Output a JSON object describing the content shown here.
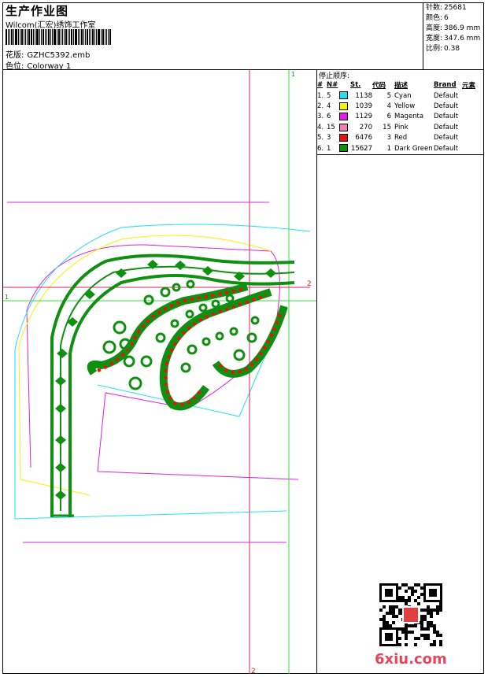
{
  "header": {
    "title": "生产作业图",
    "company": "Wilcom(汇宏)绣饰工作室",
    "design_label": "花版:",
    "design_value": "GZHC5392.emb",
    "colorway_label": "色位:",
    "colorway_value": "Colorway 1"
  },
  "stats": [
    {
      "label": "针数:",
      "value": "25681"
    },
    {
      "label": "颜色:",
      "value": "6"
    },
    {
      "label": "高度:",
      "value": "386.9 mm"
    },
    {
      "label": "宽度:",
      "value": "347.6 mm"
    },
    {
      "label": "比例:",
      "value": "0.38"
    }
  ],
  "stop_sequence": {
    "title": "停止顺序:",
    "columns": [
      "#",
      "N#",
      "St.",
      "代码",
      "描述",
      "Brand",
      "元素"
    ],
    "rows": [
      {
        "seq": "1.",
        "n": "5",
        "stitches": "1138",
        "code": "5",
        "desc": "Cyan",
        "brand": "Default",
        "color": "#22e0f0"
      },
      {
        "seq": "2.",
        "n": "4",
        "stitches": "1039",
        "code": "4",
        "desc": "Yellow",
        "brand": "Default",
        "color": "#f4f400"
      },
      {
        "seq": "3.",
        "n": "6",
        "stitches": "1129",
        "code": "6",
        "desc": "Magenta",
        "brand": "Default",
        "color": "#e020e0"
      },
      {
        "seq": "4.",
        "n": "15",
        "stitches": "270",
        "code": "15",
        "desc": "Pink",
        "brand": "Default",
        "color": "#f080b0"
      },
      {
        "seq": "5.",
        "n": "3",
        "stitches": "6476",
        "code": "3",
        "desc": "Red",
        "brand": "Default",
        "color": "#ee1010"
      },
      {
        "seq": "6.",
        "n": "1",
        "stitches": "15627",
        "code": "1",
        "desc": "Dark Green",
        "brand": "Default",
        "color": "#109010"
      }
    ]
  },
  "guides": {
    "green_label_top": "1",
    "green_label_left": "1",
    "red_label_right": "2",
    "red_label_bottom": "2"
  },
  "watermark": {
    "site": "6xiu.com"
  }
}
